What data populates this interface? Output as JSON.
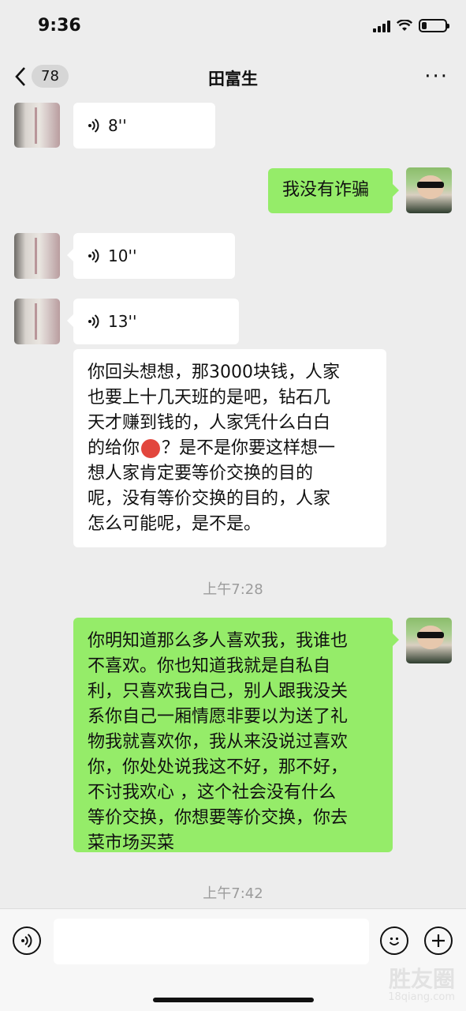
{
  "status_bar": {
    "time": "9:36",
    "battery_level": 0.2
  },
  "nav": {
    "unread_count": "78",
    "title": "田富生",
    "more_label": "···"
  },
  "messages": [
    {
      "side": "in",
      "type": "voice",
      "duration": "8''"
    },
    {
      "side": "out",
      "type": "text",
      "text": "我没有诈骗"
    },
    {
      "side": "in",
      "type": "voice",
      "duration": "10''"
    },
    {
      "side": "in",
      "type": "voice",
      "duration": "13''"
    },
    {
      "side": "in",
      "type": "text",
      "lines": [
        "你回头想想，那3000块钱，人家",
        "也要上十几天班的是吧，钻石几",
        "天才赚到钱的，人家凭什么白白",
        "的给你",
        "？是不是你要这样想一",
        "想人家肯定要等价交换的目的",
        "呢，没有等价交换的目的，人家",
        "怎么可能呢，是不是。"
      ],
      "emoji": "angry-face"
    },
    {
      "type": "timestamp",
      "text": "上午7:28"
    },
    {
      "side": "out",
      "type": "text",
      "lines": [
        "你明知道那么多人喜欢我，我谁也",
        "不喜欢。你也知道我就是自私自",
        "利，只喜欢我自己，别人跟我没关",
        "系你自己一厢情愿非要以为送了礼",
        "物我就喜欢你，我从来没说过喜欢",
        "你，你处处说我这不好，那不好，",
        "不讨我欢心 ，这个社会没有什么",
        "等价交换，你想要等价交换，你去",
        "菜市场买菜"
      ]
    },
    {
      "type": "timestamp",
      "text": "上午7:42"
    }
  ],
  "input_bar": {
    "voice_icon": "voice-mode-icon",
    "emoji_icon": "emoji-icon",
    "plus_icon": "plus-icon",
    "placeholder": ""
  },
  "watermark": {
    "main": "胜友圈",
    "sub": "18qiang.com"
  }
}
